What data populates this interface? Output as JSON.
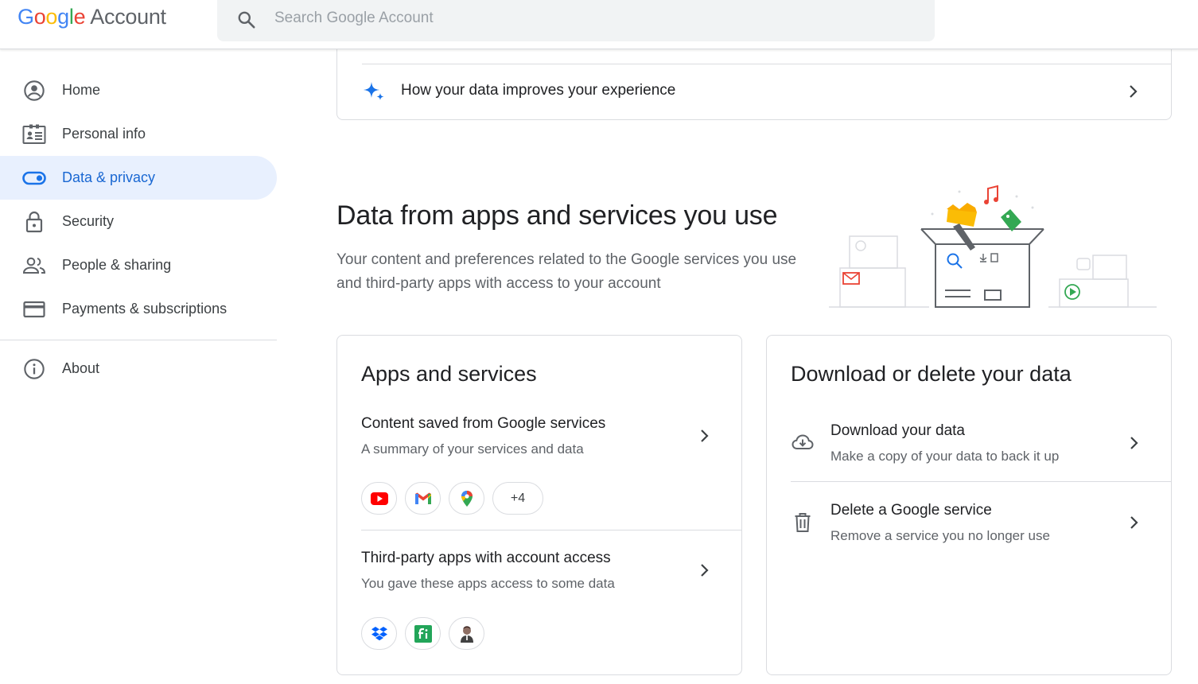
{
  "header": {
    "logo_parts": [
      "G",
      "o",
      "o",
      "g",
      "l",
      "e"
    ],
    "logo_account": "Account",
    "search_placeholder": "Search Google Account"
  },
  "sidebar": {
    "items": [
      {
        "label": "Home",
        "icon": "account-circle-icon"
      },
      {
        "label": "Personal info",
        "icon": "id-card-icon"
      },
      {
        "label": "Data & privacy",
        "icon": "toggle-icon",
        "active": true
      },
      {
        "label": "Security",
        "icon": "lock-icon"
      },
      {
        "label": "People & sharing",
        "icon": "people-icon"
      },
      {
        "label": "Payments & subscriptions",
        "icon": "credit-card-icon"
      }
    ],
    "about": {
      "label": "About",
      "icon": "info-icon"
    }
  },
  "top_card": {
    "row_label": "How your data improves your experience"
  },
  "section": {
    "title": "Data from apps and services you use",
    "description": "Your content and preferences related to the Google services you use and third-party apps with access to your account"
  },
  "apps_card": {
    "title": "Apps and services",
    "rows": [
      {
        "title": "Content saved from Google services",
        "subtitle": "A summary of your services and data",
        "chips": [
          "youtube-icon",
          "gmail-icon",
          "maps-icon"
        ],
        "more": "+4"
      },
      {
        "title": "Third-party apps with account access",
        "subtitle": "You gave these apps access to some data",
        "chips": [
          "dropbox-icon",
          "app-fi-icon",
          "person-avatar-icon"
        ]
      }
    ]
  },
  "download_card": {
    "title": "Download or delete your data",
    "rows": [
      {
        "title": "Download your data",
        "subtitle": "Make a copy of your data to back it up",
        "icon": "cloud-download-icon"
      },
      {
        "title": "Delete a Google service",
        "subtitle": "Remove a service you no longer use",
        "icon": "trash-icon"
      }
    ]
  },
  "colors": {
    "accent_blue": "#1a73e8",
    "active_bg": "#e8f0fe",
    "active_text": "#1967d2",
    "border": "#dadce0",
    "secondary_text": "#5f6368"
  }
}
